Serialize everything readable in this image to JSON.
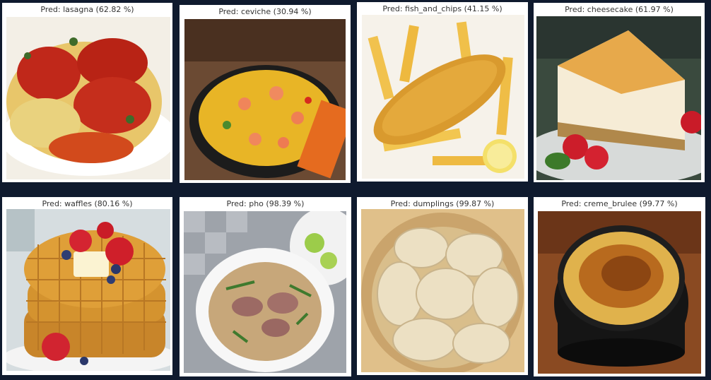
{
  "panels": [
    {
      "caption": "Pred: lasagna (62.82 %)"
    },
    {
      "caption": "Pred: ceviche (30.94 %)"
    },
    {
      "caption": "Pred: fish_and_chips (41.15 %)"
    },
    {
      "caption": "Pred: cheesecake (61.97 %)"
    },
    {
      "caption": "Pred: waffles (80.16 %)"
    },
    {
      "caption": "Pred: pho (98.39 %)"
    },
    {
      "caption": "Pred: dumplings (99.87 %)"
    },
    {
      "caption": "Pred: creme_brulee (99.77 %)"
    }
  ]
}
